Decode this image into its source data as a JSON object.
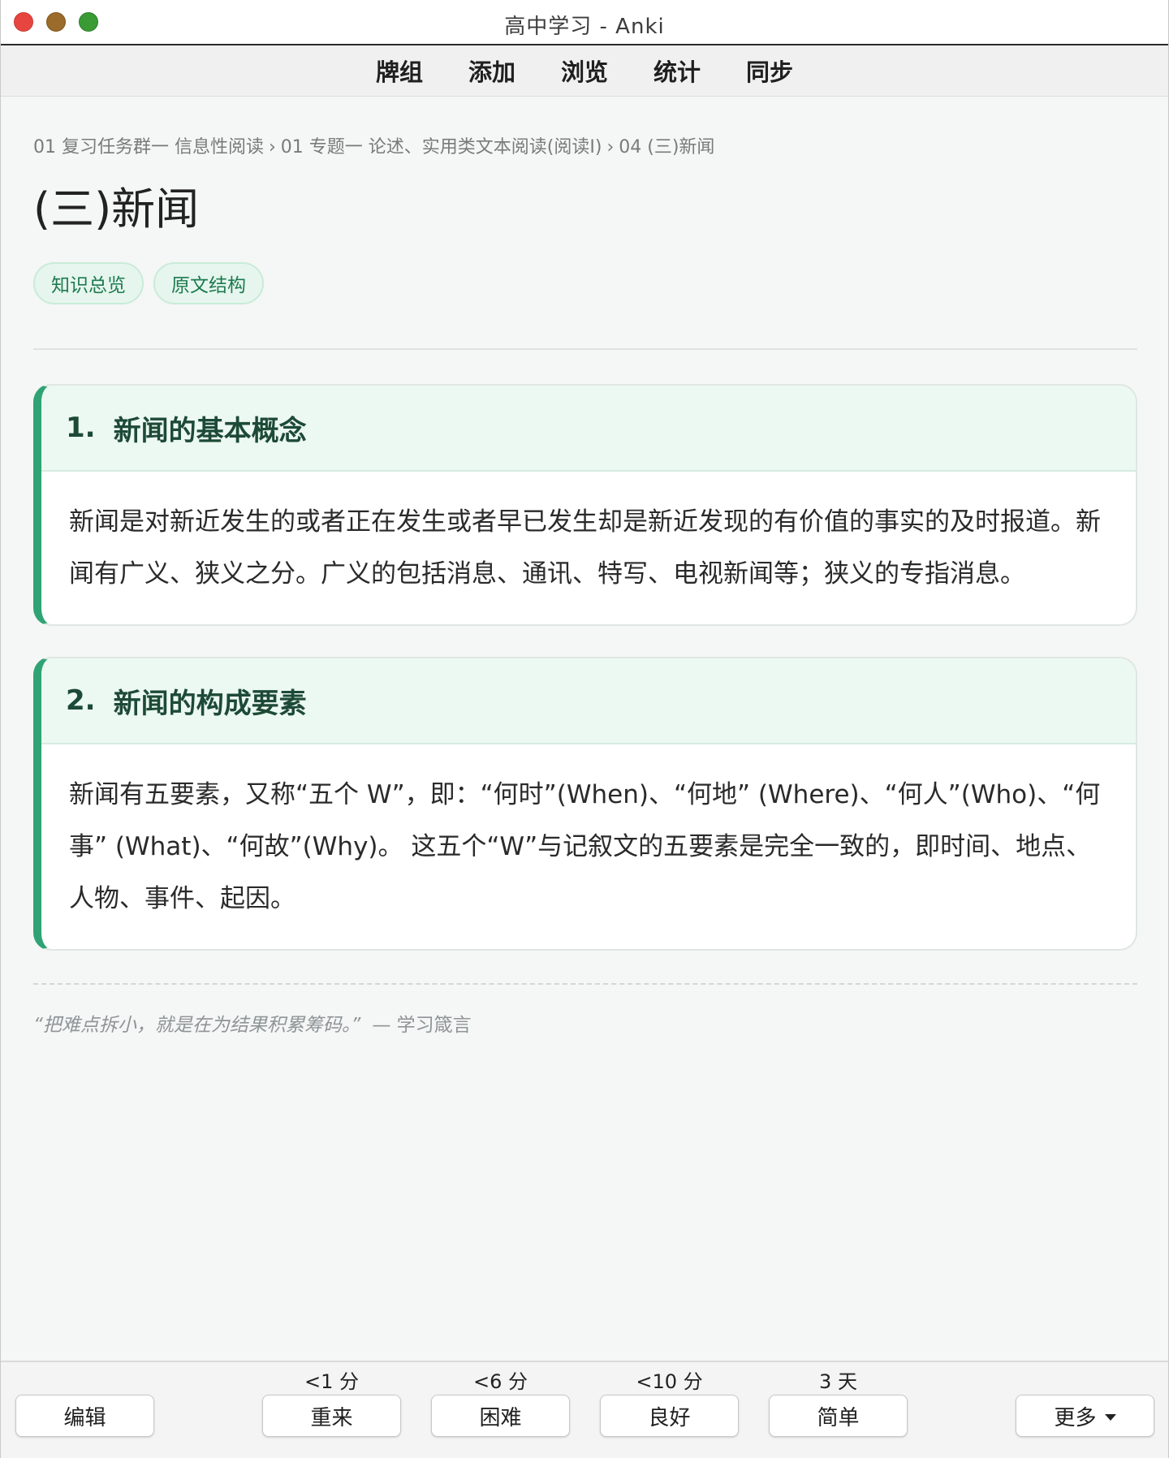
{
  "window": {
    "title": "高中学习 - Anki"
  },
  "topmenu": {
    "items": [
      "牌组",
      "添加",
      "浏览",
      "统计",
      "同步"
    ]
  },
  "breadcrumb": {
    "items": [
      "01 复习任务群一 信息性阅读",
      "01 专题一 论述、实用类文本阅读(阅读I)",
      "04 (三)新闻"
    ],
    "separator": "›"
  },
  "page": {
    "title": "(三)新闻"
  },
  "tags": [
    "知识总览",
    "原文结构"
  ],
  "cards": [
    {
      "number": "1.",
      "title": "新闻的基本概念",
      "body": "新闻是对新近发生的或者正在发生或者早已发生却是新近发现的有价值的事实的及时报道。新闻有广义、狭义之分。广义的包括消息、通讯、特写、电视新闻等；狭义的专指消息。"
    },
    {
      "number": "2.",
      "title": "新闻的构成要素",
      "body": "新闻有五要素，又称“五个 W”，即：“何时”(When)、“何地” (Where)、“何人”(Who)、“何事” (What)、“何故”(Why)。 这五个“W”与记叙文的五要素是完全一致的，即时间、地点、人物、事件、起因。"
    }
  ],
  "quote": {
    "text": "“把难点拆小，就是在为结果积累筹码。”",
    "source": "— 学习箴言"
  },
  "bottombar": {
    "edit_label": "编辑",
    "more_label": "更多",
    "answers": [
      {
        "interval": "<1 分",
        "label": "重来"
      },
      {
        "interval": "<6 分",
        "label": "困难"
      },
      {
        "interval": "<10 分",
        "label": "良好"
      },
      {
        "interval": "3 天",
        "label": "简单"
      }
    ]
  },
  "colors": {
    "accent": "#2fa374",
    "card_header_bg": "#ecf8f2",
    "tag_bg": "#e6f6ee",
    "tag_text": "#1e7a4f"
  }
}
